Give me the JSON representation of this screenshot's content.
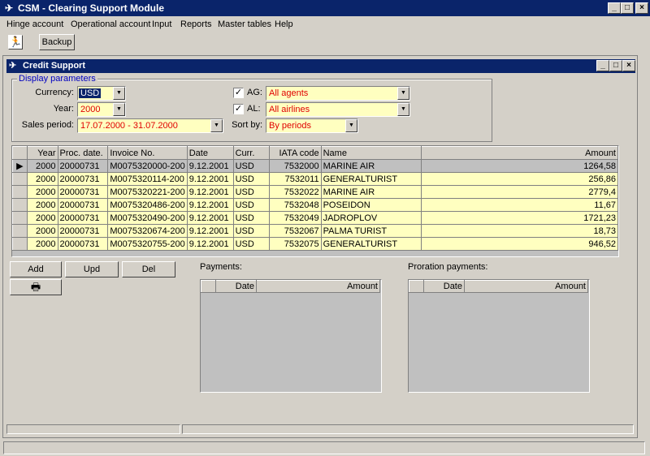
{
  "app": {
    "title": "CSM - Clearing Support Module"
  },
  "window_controls": {
    "minimize": "_",
    "maximize": "□",
    "close": "×"
  },
  "menu": [
    "Hinge account",
    "Operational account",
    "Input",
    "Reports",
    "Master tables",
    "Help"
  ],
  "toolbar": {
    "backup_label": "Backup"
  },
  "child": {
    "title": "Credit Support"
  },
  "params": {
    "legend": "Display parameters",
    "currency_label": "Currency:",
    "currency_value": "USD",
    "year_label": "Year:",
    "year_value": "2000",
    "sales_period_label": "Sales period:",
    "sales_period_value": "17.07.2000 - 31.07.2000",
    "ag_label": "AG:",
    "ag_value": "All agents",
    "al_label": "AL:",
    "al_value": "All airlines",
    "sortby_label": "Sort by:",
    "sortby_value": "By periods"
  },
  "grid": {
    "columns": [
      "Year",
      "Proc. date.",
      "Invoice No.",
      "Date",
      "Curr.",
      "IATA code",
      "Name",
      "Amount"
    ],
    "rows": [
      [
        "2000",
        "20000731",
        "M0075320000-200",
        "9.12.2001",
        "USD",
        "7532000",
        "MARINE AIR",
        "1264,58"
      ],
      [
        "2000",
        "20000731",
        "M0075320114-200",
        "9.12.2001",
        "USD",
        "7532011",
        "GENERALTURIST",
        "256,86"
      ],
      [
        "2000",
        "20000731",
        "M0075320221-200",
        "9.12.2001",
        "USD",
        "7532022",
        "MARINE AIR",
        "2779,4"
      ],
      [
        "2000",
        "20000731",
        "M0075320486-200",
        "9.12.2001",
        "USD",
        "7532048",
        "POSEIDON",
        "11,67"
      ],
      [
        "2000",
        "20000731",
        "M0075320490-200",
        "9.12.2001",
        "USD",
        "7532049",
        "JADROPLOV",
        "1721,23"
      ],
      [
        "2000",
        "20000731",
        "M0075320674-200",
        "9.12.2001",
        "USD",
        "7532067",
        "PALMA TURIST",
        "18,73"
      ],
      [
        "2000",
        "20000731",
        "M0075320755-200",
        "9.12.2001",
        "USD",
        "7532075",
        "GENERALTURIST",
        "946,52"
      ]
    ]
  },
  "buttons": {
    "add": "Add",
    "upd": "Upd",
    "del": "Del"
  },
  "payments": {
    "label": "Payments:",
    "date_col": "Date",
    "amount_col": "Amount"
  },
  "proration": {
    "label": "Proration payments:",
    "date_col": "Date",
    "amount_col": "Amount"
  }
}
